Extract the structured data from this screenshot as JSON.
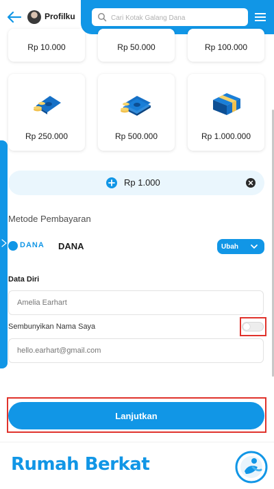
{
  "header": {
    "profile_label": "Profilku",
    "search_placeholder": "Cari Kotak Galang Dana"
  },
  "donation_options": [
    {
      "amount": "Rp 10.000"
    },
    {
      "amount": "Rp 50.000"
    },
    {
      "amount": "Rp 100.000"
    },
    {
      "amount": "Rp 250.000"
    },
    {
      "amount": "Rp 500.000"
    },
    {
      "amount": "Rp 1.000.000"
    }
  ],
  "custom_amount": {
    "value": "Rp 1.000"
  },
  "payment": {
    "section_title": "Metode Pembayaran",
    "logo_text": "DANA",
    "method_name": "DANA",
    "change_label": "Ubah"
  },
  "personal_data": {
    "title": "Data Diri",
    "name_placeholder": "Amelia Earhart",
    "hide_name_label": "Sembunyikan Nama Saya",
    "hide_name_enabled": false,
    "email_placeholder": "hello.earhart@gmail.com"
  },
  "continue_label": "Lanjutkan",
  "footer": {
    "brand_name": "Rumah Berkat"
  },
  "colors": {
    "primary": "#1196e6",
    "highlight": "#e0322b",
    "amount_bar": "#eaf6fd"
  },
  "icons": [
    "back-arrow-icon",
    "search-icon",
    "hamburger-menu-icon",
    "plus-icon",
    "clear-icon",
    "chevron-right-icon",
    "chevron-down-icon"
  ]
}
